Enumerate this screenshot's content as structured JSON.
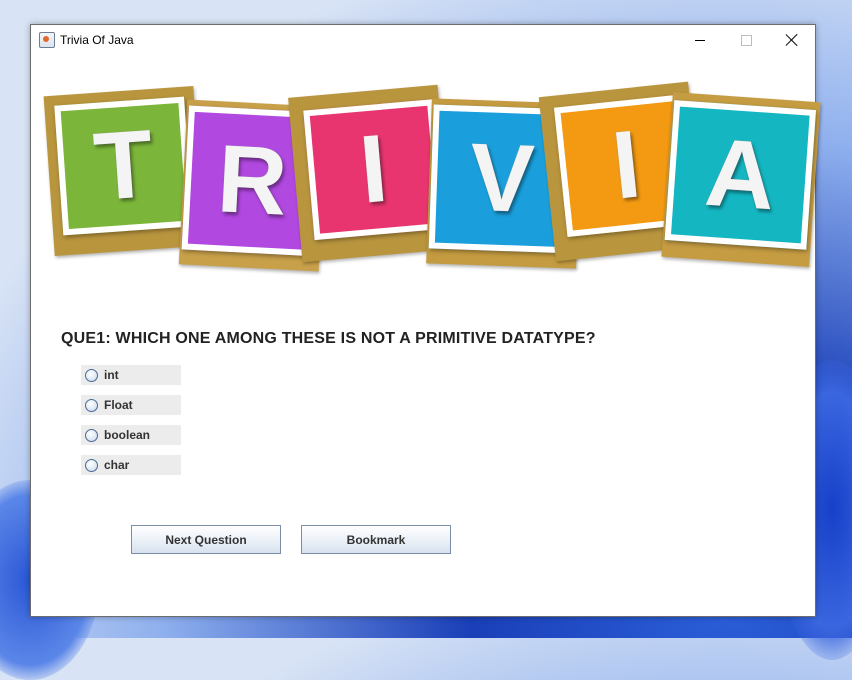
{
  "window": {
    "title": "Trivia Of Java"
  },
  "banner": {
    "tiles": [
      {
        "letter": "T",
        "color": "#7bb53a"
      },
      {
        "letter": "R",
        "color": "#b148e0"
      },
      {
        "letter": "I",
        "color": "#e8356f"
      },
      {
        "letter": "V",
        "color": "#1a9fdc"
      },
      {
        "letter": "I",
        "color": "#f39a12"
      },
      {
        "letter": "A",
        "color": "#14b6c2"
      }
    ]
  },
  "question": {
    "text": "QUE1: WHICH ONE AMONG THESE IS NOT A PRIMITIVE DATATYPE?"
  },
  "options": [
    {
      "label": "int",
      "selected": false
    },
    {
      "label": "Float",
      "selected": false
    },
    {
      "label": "boolean",
      "selected": false
    },
    {
      "label": "char",
      "selected": false
    }
  ],
  "buttons": {
    "next": "Next Question",
    "bookmark": "Bookmark"
  },
  "icons": {
    "app": "java-cup-icon",
    "minimize": "minimize-icon",
    "maximize": "maximize-icon",
    "close": "close-icon"
  }
}
